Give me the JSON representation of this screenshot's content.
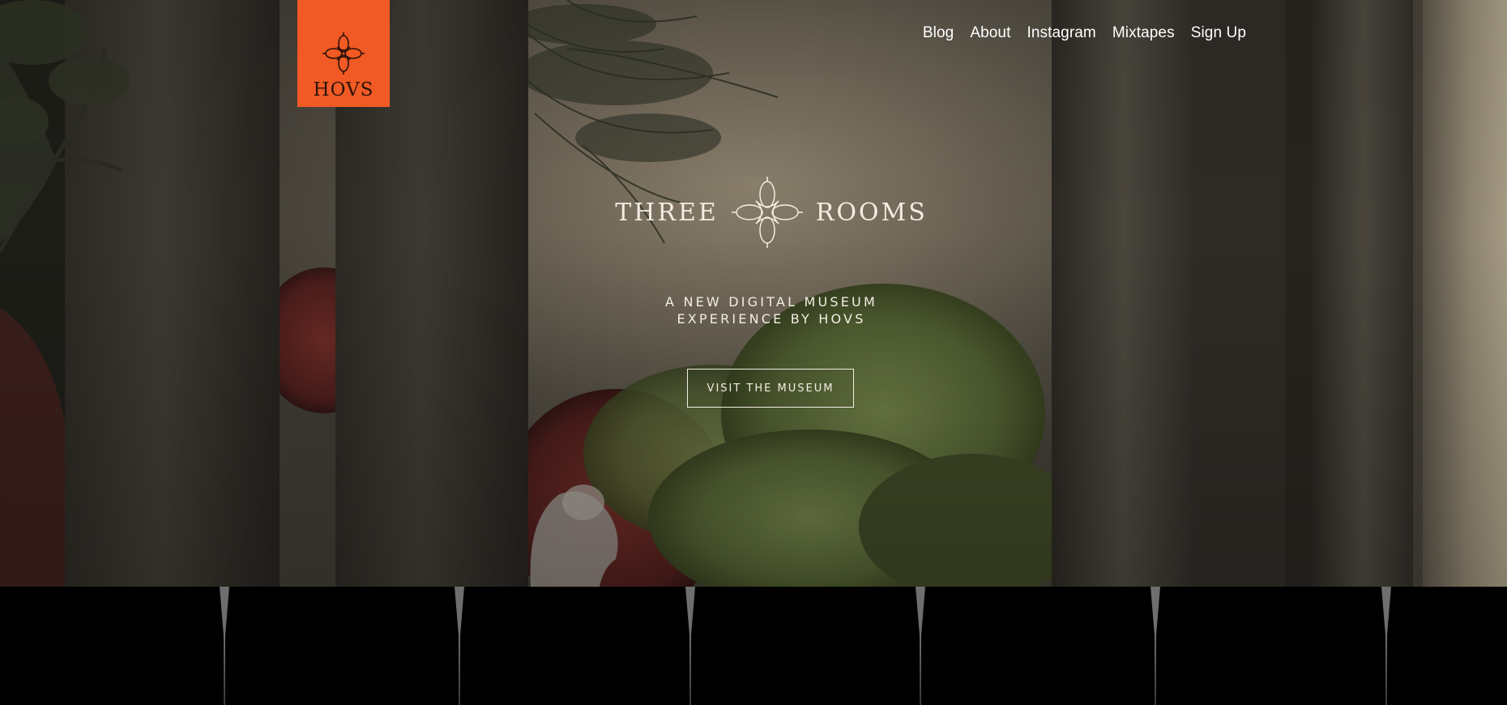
{
  "logo": {
    "text": "HOVS",
    "icon": "quatrefoil-knot-icon",
    "color": "#f15a24"
  },
  "nav": {
    "items": [
      {
        "label": "Blog"
      },
      {
        "label": "About"
      },
      {
        "label": "Instagram"
      },
      {
        "label": "Mixtapes"
      },
      {
        "label": "Sign Up"
      }
    ]
  },
  "hero": {
    "title_left": "THREE",
    "title_right": "ROOMS",
    "title_icon": "quatrefoil-knot-icon",
    "subtitle_line1": "A NEW DIGITAL MUSEUM",
    "subtitle_line2": "EXPERIENCE BY HOVS",
    "cta_label": "VISIT THE MUSEUM"
  },
  "colors": {
    "accent": "#f15a24",
    "text_light": "#f3ede2",
    "bottom_bg": "#000000"
  }
}
